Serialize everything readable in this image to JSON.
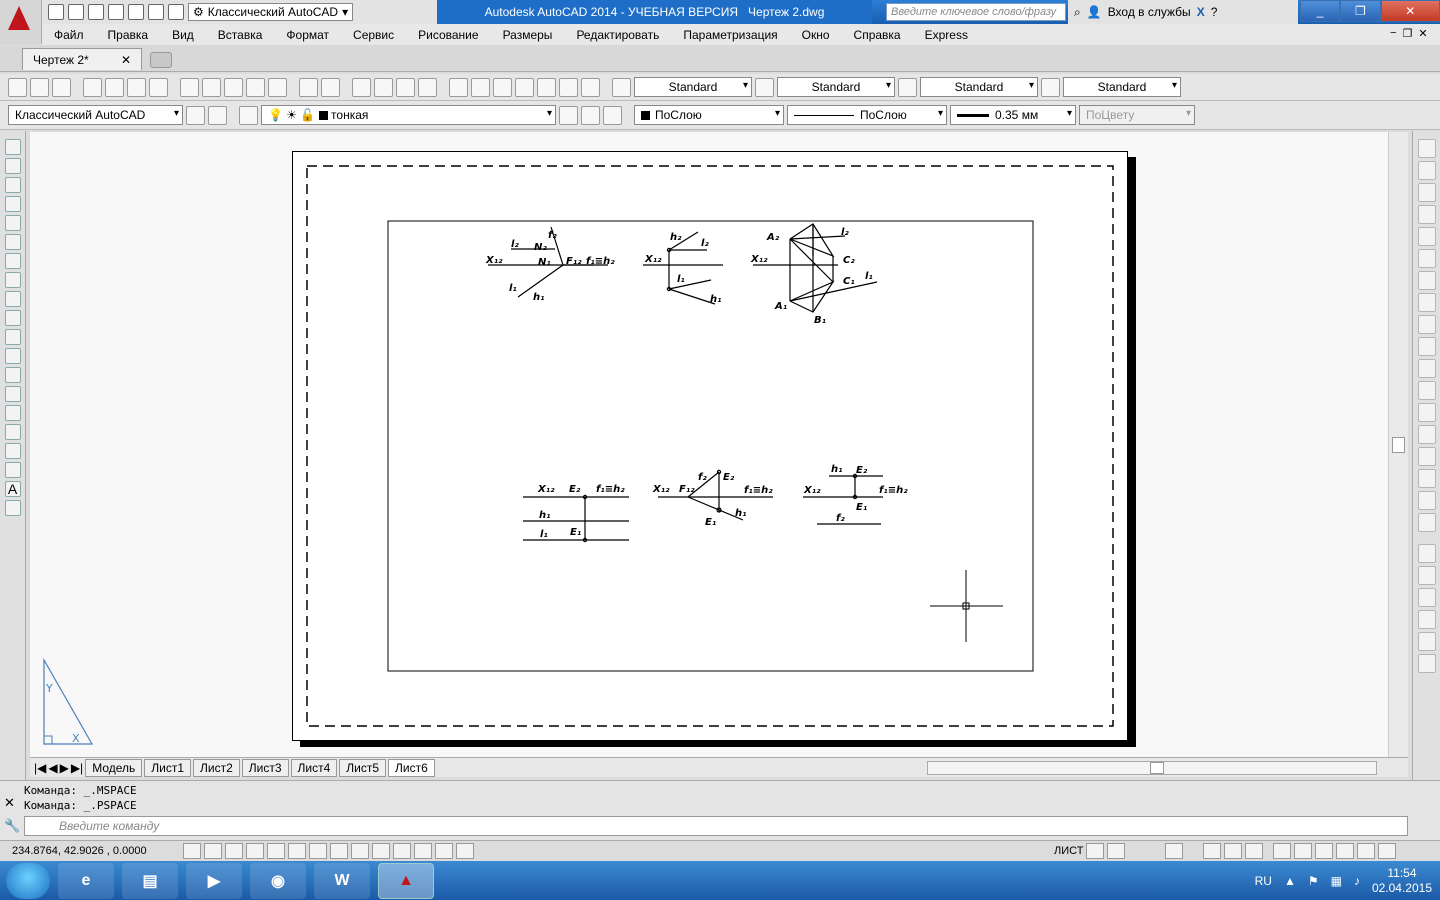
{
  "titlebar": {
    "workspace": "Классический AutoCAD",
    "title": "Autodesk AutoCAD 2014 - УЧЕБНАЯ ВЕРСИЯ",
    "file": "Чертеж 2.dwg",
    "search_placeholder": "Введите ключевое слово/фразу",
    "signin": "Вход в службы"
  },
  "menu": [
    "Файл",
    "Правка",
    "Вид",
    "Вставка",
    "Формат",
    "Сервис",
    "Рисование",
    "Размеры",
    "Редактировать",
    "Параметризация",
    "Окно",
    "Справка",
    "Express"
  ],
  "doc_tab": "Чертеж 2*",
  "styles": {
    "text": "Standard",
    "dim": "Standard",
    "table": "Standard",
    "mleader": "Standard"
  },
  "layers": {
    "workspace": "Классический AutoCAD",
    "layer": "тонкая",
    "color": "ПоСлою",
    "linetype": "ПоСлою",
    "lineweight": "0.35 мм",
    "plotstyle": "ПоЦвету"
  },
  "layout_tabs": [
    "Модель",
    "Лист1",
    "Лист2",
    "Лист3",
    "Лист4",
    "Лист5",
    "Лист6"
  ],
  "active_layout": "Лист6",
  "command": {
    "line1": "Команда:  _.MSPACE",
    "line2": "Команда:  _.PSPACE",
    "placeholder": "Введите команду"
  },
  "status": {
    "coords": "234.8764,  42.9026  , 0.0000",
    "mode": "ЛИСТ"
  },
  "tray": {
    "lang": "RU",
    "time": "11:54",
    "date": "02.04.2015"
  },
  "drawing_labels": {
    "f2": "f₂",
    "l2": "l₂",
    "N2": "N₂",
    "N1": "N₁",
    "Xpi": "X₁₂",
    "Fpi": "F₁₂",
    "f1h2": "f₁≡h₂",
    "l1": "l₁",
    "h1": "h₁",
    "h2": "h₂",
    "A2": "A₂",
    "C2": "C₂",
    "C1": "C₁",
    "A1": "A₁",
    "B1": "B₁",
    "E2": "E₂",
    "E1": "E₁"
  }
}
